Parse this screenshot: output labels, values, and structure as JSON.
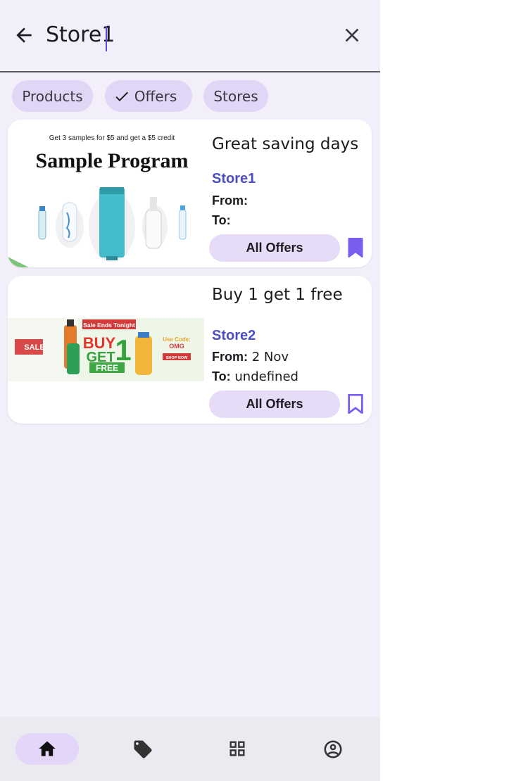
{
  "search": {
    "query": "Store1"
  },
  "filters": [
    {
      "label": "Products",
      "selected": false
    },
    {
      "label": "Offers",
      "selected": true
    },
    {
      "label": "Stores",
      "selected": false
    }
  ],
  "offers": [
    {
      "title": "Great saving days",
      "store": "Store1",
      "from_label": "From:",
      "from_value": "",
      "to_label": "To:",
      "to_value": "",
      "button_label": "All Offers",
      "bookmarked": true,
      "image": {
        "headline": "Get 3 samples for $5 and get a $5 credit",
        "title": "Sample Program"
      }
    },
    {
      "title": "Buy 1 get 1 free",
      "store": "Store2",
      "from_label": "From:",
      "from_value": "2  Nov",
      "to_label": "To:",
      "to_value": "undefined",
      "button_label": "All Offers",
      "bookmarked": false,
      "image": {
        "banner": "Sale Ends Tonight",
        "buy": "BUY",
        "one": "1",
        "get": "GET",
        "free": "FREE",
        "sale": "SALE",
        "code_label": "Use Code:",
        "code": "OMG",
        "shop": "SHOP NOW"
      }
    }
  ],
  "nav": [
    {
      "icon": "home-icon",
      "active": true
    },
    {
      "icon": "tag-icon",
      "active": false
    },
    {
      "icon": "grid-icon",
      "active": false
    },
    {
      "icon": "account-circle-icon",
      "active": false
    }
  ],
  "colors": {
    "background": "#f3effa",
    "chip": "#e2d6f7",
    "accent": "#7a5cf0",
    "store_link": "#4a4dc4"
  }
}
